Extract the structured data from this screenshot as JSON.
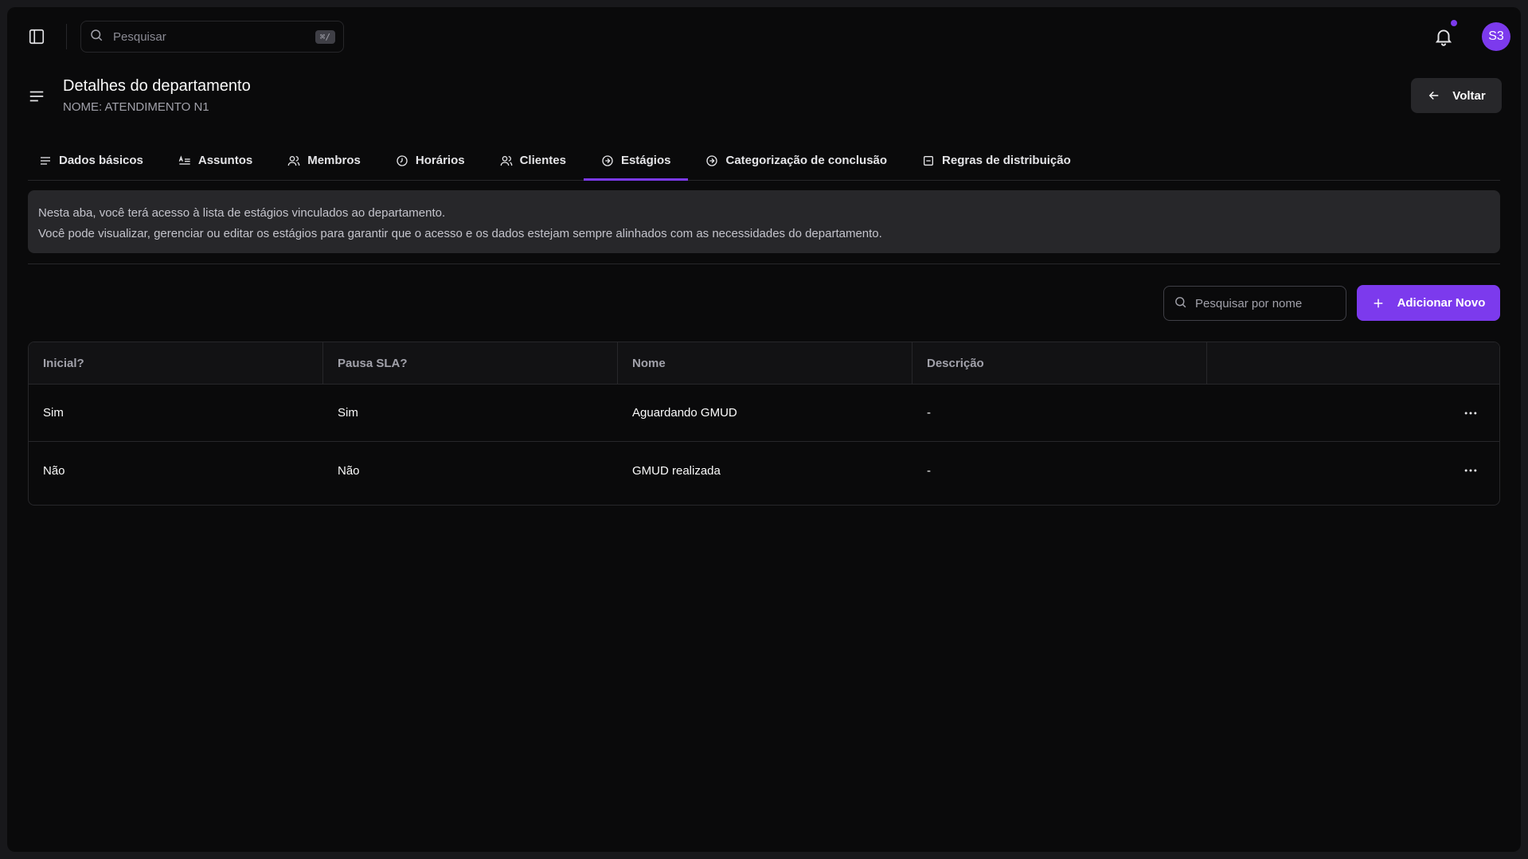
{
  "topbar": {
    "search_placeholder": "Pesquisar",
    "search_shortcut": "⌘/",
    "avatar_initials": "S3"
  },
  "header": {
    "title": "Detalhes do departamento",
    "subtitle": "NOME: ATENDIMENTO N1",
    "back_label": "Voltar"
  },
  "tabs": [
    {
      "label": "Dados básicos",
      "icon": "align-left-icon"
    },
    {
      "label": "Assuntos",
      "icon": "text-list-icon"
    },
    {
      "label": "Membros",
      "icon": "users-icon"
    },
    {
      "label": "Horários",
      "icon": "clock-icon"
    },
    {
      "label": "Clientes",
      "icon": "users-icon"
    },
    {
      "label": "Estágios",
      "icon": "arrow-circle-icon",
      "active": true
    },
    {
      "label": "Categorização de conclusão",
      "icon": "arrow-circle-icon"
    },
    {
      "label": "Regras de distribuição",
      "icon": "square-minus-icon"
    }
  ],
  "info": {
    "line1": "Nesta aba, você terá acesso à lista de estágios vinculados ao departamento.",
    "line2": "Você pode visualizar, gerenciar ou editar os estágios para garantir que o acesso e os dados estejam sempre alinhados com as necessidades do departamento."
  },
  "table_actions": {
    "search_placeholder": "Pesquisar por nome",
    "add_label": "Adicionar Novo"
  },
  "table": {
    "headers": [
      "Inicial?",
      "Pausa SLA?",
      "Nome",
      "Descrição",
      ""
    ],
    "rows": [
      [
        "Sim",
        "Sim",
        "Aguardando GMUD",
        "-"
      ],
      [
        "Não",
        "Não",
        "GMUD realizada",
        "-"
      ]
    ]
  },
  "colors": {
    "accent": "#7c3aed",
    "background": "#0a0a0b",
    "surface": "#27272a"
  }
}
